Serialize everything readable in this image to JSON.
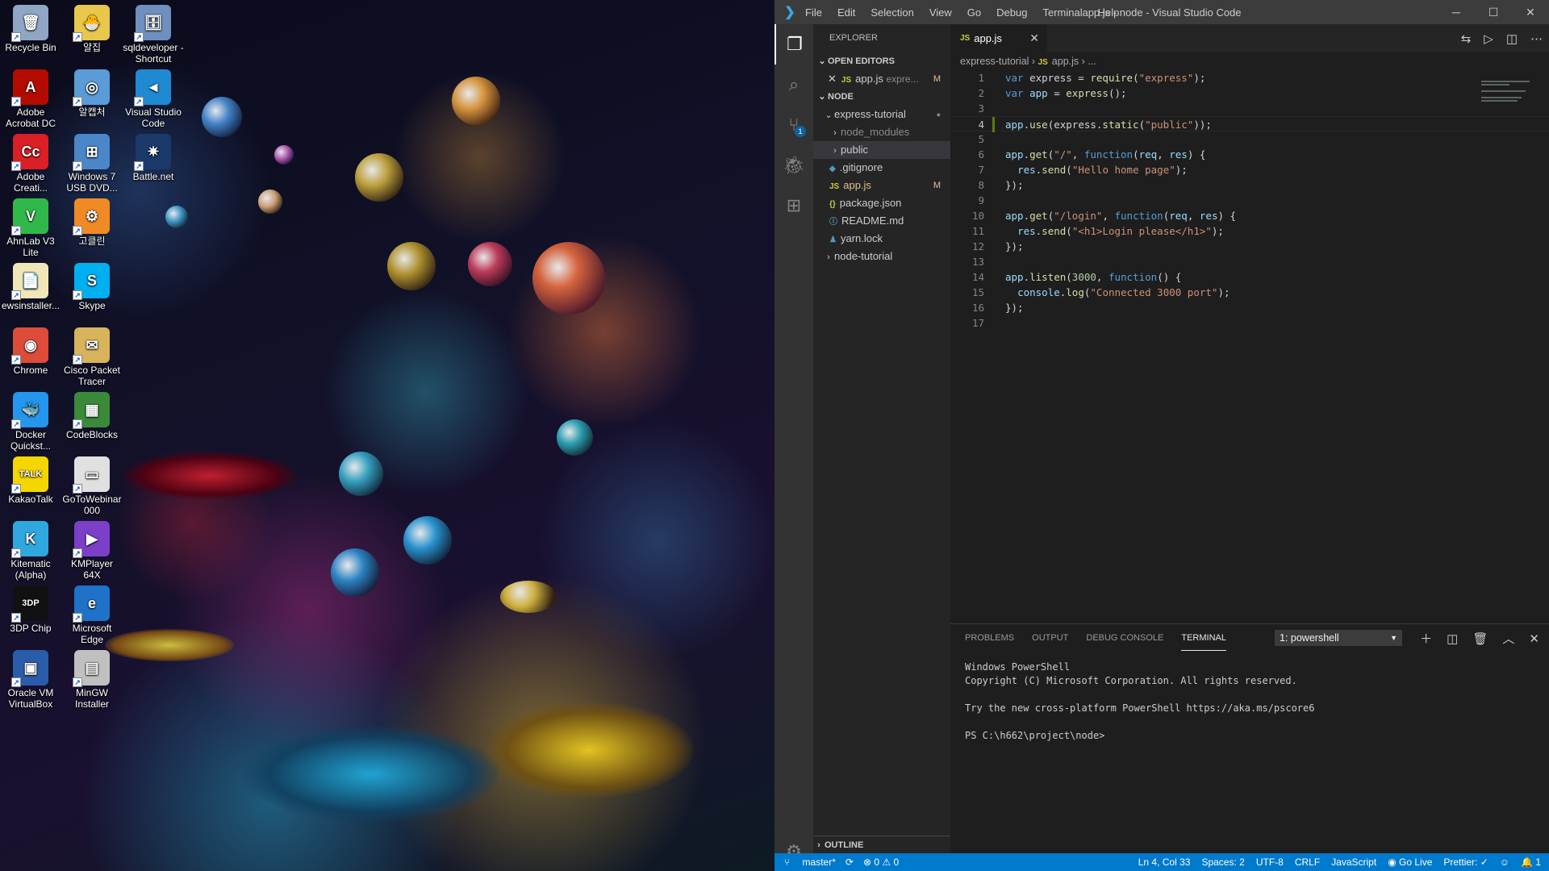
{
  "desktop": {
    "icons": [
      {
        "label": "Recycle Bin",
        "color": "#8fa6c4",
        "glyph": "🗑"
      },
      {
        "label": "얄집",
        "color": "#e8c84c",
        "glyph": "🐣"
      },
      {
        "label": "sqldeveloper - Shortcut",
        "color": "#6f8fbf",
        "glyph": "🗄"
      },
      {
        "label": "Adobe Acrobat DC",
        "color": "#b30b00",
        "glyph": "A"
      },
      {
        "label": "알캡처",
        "color": "#5a9bd8",
        "glyph": "◎"
      },
      {
        "label": "Visual Studio Code",
        "color": "#1f8ad2",
        "glyph": "◄"
      },
      {
        "label": "Adobe Creati...",
        "color": "#da1f26",
        "glyph": "Cc"
      },
      {
        "label": "Windows 7 USB DVD...",
        "color": "#4a86c8",
        "glyph": "⊞"
      },
      {
        "label": "Battle.net",
        "color": "#1b3a6b",
        "glyph": "✷"
      },
      {
        "label": "AhnLab V3 Lite",
        "color": "#30b94a",
        "glyph": "V"
      },
      {
        "label": "고클린",
        "color": "#f08a24",
        "glyph": "⚙"
      },
      {
        "label": "ewsinstaller...",
        "color": "#f1e6b8",
        "glyph": "📄"
      },
      {
        "label": "Skype",
        "color": "#00aff0",
        "glyph": "S"
      },
      {
        "label": "Chrome",
        "color": "#dd4b39",
        "glyph": "◉"
      },
      {
        "label": "Cisco Packet Tracer",
        "color": "#d7b45b",
        "glyph": "✉"
      },
      {
        "label": "Docker Quickst...",
        "color": "#2496ed",
        "glyph": "🐳"
      },
      {
        "label": "CodeBlocks",
        "color": "#3a8a3a",
        "glyph": "▦"
      },
      {
        "label": "KakaoTalk",
        "color": "#f6d600",
        "glyph": "TALK"
      },
      {
        "label": "GoToWebinar 000",
        "color": "#e0e0e0",
        "glyph": "▭"
      },
      {
        "label": "Kitematic (Alpha)",
        "color": "#2fa8e0",
        "glyph": "K"
      },
      {
        "label": "KMPlayer 64X",
        "color": "#7b3fc8",
        "glyph": "▶"
      },
      {
        "label": "3DP Chip",
        "color": "#111111",
        "glyph": "3DP"
      },
      {
        "label": "Microsoft Edge",
        "color": "#1e73c8",
        "glyph": "e"
      },
      {
        "label": "Oracle VM VirtualBox",
        "color": "#2a5caa",
        "glyph": "▣"
      },
      {
        "label": "MinGW Installer",
        "color": "#c0c0c0",
        "glyph": "▤"
      }
    ]
  },
  "vscode": {
    "title_bar": {
      "menu": [
        "File",
        "Edit",
        "Selection",
        "View",
        "Go",
        "Debug",
        "Terminal",
        "Help"
      ],
      "window_title": "app.js - node - Visual Studio Code"
    },
    "sidebar": {
      "header": "EXPLORER",
      "open_editors_label": "OPEN EDITORS",
      "open_editor": {
        "name": "app.js",
        "path": "expre...",
        "status": "M"
      },
      "workspace_label": "NODE",
      "tree": [
        {
          "name": "express-tutorial",
          "indent": 1,
          "chev": "down",
          "mark": "●"
        },
        {
          "name": "node_modules",
          "indent": 2,
          "chev": "right",
          "dim": true
        },
        {
          "name": "public",
          "indent": 2,
          "chev": "right",
          "selected": true
        },
        {
          "name": ".gitignore",
          "indent": 2,
          "icon": "◆"
        },
        {
          "name": "app.js",
          "indent": 2,
          "icon": "JS",
          "mark": "M"
        },
        {
          "name": "package.json",
          "indent": 2,
          "icon": "{}"
        },
        {
          "name": "README.md",
          "indent": 2,
          "icon": "ⓘ"
        },
        {
          "name": "yarn.lock",
          "indent": 2,
          "icon": "♟"
        },
        {
          "name": "node-tutorial",
          "indent": 1,
          "chev": "right"
        }
      ],
      "outline_label": "OUTLINE"
    },
    "tab": {
      "label": "app.js"
    },
    "breadcrumb": {
      "folder": "express-tutorial",
      "file": "app.js",
      "rest": "..."
    },
    "code_lines": [
      "var express = require(\"express\");",
      "var app = express();",
      "",
      "app.use(express.static(\"public\"));",
      "",
      "app.get(\"/\", function(req, res) {",
      "  res.send(\"Hello home page\");",
      "});",
      "",
      "app.get(\"/login\", function(req, res) {",
      "  res.send(\"<h1>Login please</h1>\");",
      "});",
      "",
      "app.listen(3000, function() {",
      "  console.log(\"Connected 3000 port\");",
      "});",
      ""
    ],
    "current_line": 4,
    "panel": {
      "tabs": [
        "PROBLEMS",
        "OUTPUT",
        "DEBUG CONSOLE",
        "TERMINAL"
      ],
      "active_tab": "TERMINAL",
      "terminal_select": "1: powershell",
      "terminal_lines": [
        "Windows PowerShell",
        "Copyright (C) Microsoft Corporation. All rights reserved.",
        "",
        "Try the new cross-platform PowerShell https://aka.ms/pscore6",
        "",
        "PS C:\\h662\\project\\node>"
      ]
    },
    "status_bar": {
      "branch": "master*",
      "sync": "⟳",
      "problems": "⊗ 0 ⚠ 0",
      "position": "Ln 4, Col 33",
      "spaces": "Spaces: 2",
      "encoding": "UTF-8",
      "eol": "CRLF",
      "language": "JavaScript",
      "go_live": "Go Live",
      "prettier": "Prettier: ✓",
      "feedback": "☺",
      "notifications": "🔔 1"
    },
    "scm_badge": "1"
  }
}
